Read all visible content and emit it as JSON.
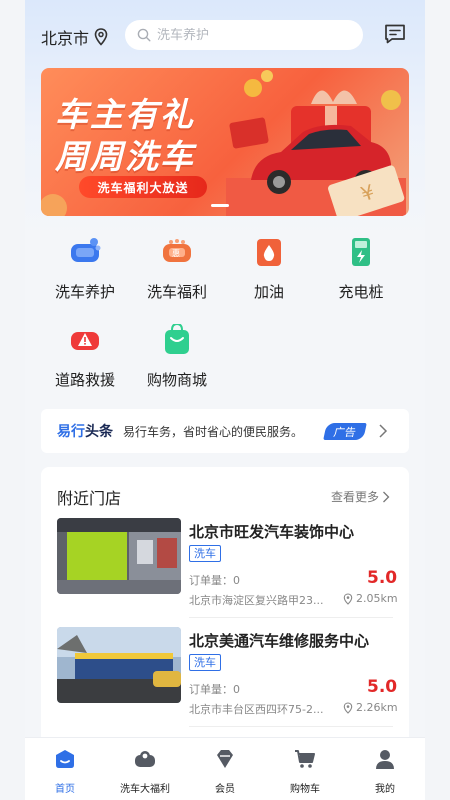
{
  "header": {
    "city": "北京市",
    "search_placeholder": "洗车养护"
  },
  "banner": {
    "title_line1": "车主有礼",
    "title_line2": "周周洗车",
    "pill_text": "洗车福利大放送"
  },
  "quick_entries": [
    {
      "label": "洗车养护",
      "icon": "car-wash-icon"
    },
    {
      "label": "洗车福利",
      "icon": "coupon-car-icon"
    },
    {
      "label": "加油",
      "icon": "fuel-drop-icon"
    },
    {
      "label": "充电桩",
      "icon": "charger-icon"
    },
    {
      "label": "道路救援",
      "icon": "warning-car-icon"
    },
    {
      "label": "购物商城",
      "icon": "shopping-bag-icon"
    }
  ],
  "headline": {
    "brand_a": "易行",
    "brand_b": "头条",
    "text": "易行车务，省时省心的便民服务。",
    "ad_label": "广告"
  },
  "nearby": {
    "title": "附近门店",
    "more_label": "查看更多",
    "stores": [
      {
        "name": "北京市旺发汽车装饰中心",
        "tag": "洗车",
        "orders": "订单量：0",
        "score": "5.0",
        "address": "北京市海淀区复兴路甲23...",
        "distance": "2.05km"
      },
      {
        "name": "北京美通汽车维修服务中心",
        "tag": "洗车",
        "orders": "订单量：0",
        "score": "5.0",
        "address": "北京市丰台区西四环75-2...",
        "distance": "2.26km"
      }
    ]
  },
  "tabs": [
    {
      "label": "首页",
      "icon": "home-icon",
      "active": true
    },
    {
      "label": "洗车大福利",
      "icon": "car-gift-icon",
      "active": false
    },
    {
      "label": "会员",
      "icon": "diamond-icon",
      "active": false
    },
    {
      "label": "购物车",
      "icon": "cart-icon",
      "active": false
    },
    {
      "label": "我的",
      "icon": "user-icon",
      "active": false
    }
  ],
  "colors": {
    "accent": "#2f6fe6",
    "score_red": "#e22828",
    "banner_orange": "#f7613e"
  }
}
